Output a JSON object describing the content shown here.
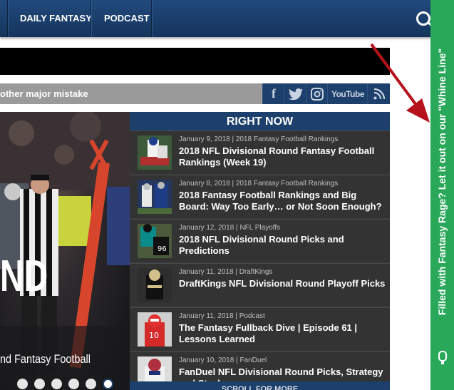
{
  "nav": {
    "items": [
      "DAILY FANTASY",
      "PODCAST"
    ]
  },
  "ticker": {
    "text": "other major mistake"
  },
  "social": {
    "facebook": "f",
    "youtube": "YouTube"
  },
  "hero": {
    "big_text": "ND",
    "subtitle": "nd Fantasy Football",
    "dots": 6,
    "active_dot": 5
  },
  "right_now": {
    "title": "RIGHT NOW",
    "scroll_label": "SCROLL FOR MORE",
    "items": [
      {
        "date": "January 9, 2018",
        "category": "2018 Fantasy Football Rankings",
        "title": "2018 NFL Divisional Round Fantasy Football Rankings (Week 19)"
      },
      {
        "date": "January 8, 2018",
        "category": "2018 Fantasy Football Rankings",
        "title": "2018 Fantasy Football Rankings and Big Board: Way Too Early… or Not Soon Enough?"
      },
      {
        "date": "January 12, 2018",
        "category": "NFL Playoffs",
        "title": "2018 NFL Divisional Round Picks and Predictions"
      },
      {
        "date": "January 11, 2018",
        "category": "DraftKings",
        "title": "DraftKings NFL Divisional Round Playoff Picks"
      },
      {
        "date": "January 11, 2018",
        "category": "Podcast",
        "title": "The Fantasy Fullback Dive | Episode 61 | Lessons Learned"
      },
      {
        "date": "January 10, 2018",
        "category": "FanDuel",
        "title": "FanDuel NFL Divisional Round Picks, Strategy and Stacks"
      }
    ]
  },
  "side_tab": {
    "text": "Filled with Fantasy Rage? Let it out on our \"Whine Line\""
  },
  "colors": {
    "nav": "#1b3d68",
    "accent_green": "#29a85a",
    "arrow": "#b5121b"
  }
}
